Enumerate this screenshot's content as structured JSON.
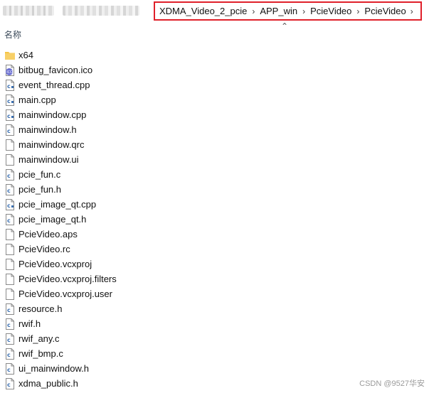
{
  "address_bar": {
    "breadcrumbs": [
      "XDMA_Video_2_pcie",
      "APP_win",
      "PcieVideo",
      "PcieVideo"
    ],
    "separator": "›"
  },
  "collapse_chevron": "⌃",
  "columns": {
    "name_header": "名称"
  },
  "files": [
    {
      "name": "x64",
      "icon": "folder-icon"
    },
    {
      "name": "bitbug_favicon.ico",
      "icon": "ico-file-icon"
    },
    {
      "name": "event_thread.cpp",
      "icon": "cpp-file-icon"
    },
    {
      "name": "main.cpp",
      "icon": "cpp-file-icon"
    },
    {
      "name": "mainwindow.cpp",
      "icon": "cpp-file-icon"
    },
    {
      "name": "mainwindow.h",
      "icon": "header-file-icon"
    },
    {
      "name": "mainwindow.qrc",
      "icon": "generic-file-icon"
    },
    {
      "name": "mainwindow.ui",
      "icon": "generic-file-icon"
    },
    {
      "name": "pcie_fun.c",
      "icon": "c-file-icon"
    },
    {
      "name": "pcie_fun.h",
      "icon": "header-file-icon"
    },
    {
      "name": "pcie_image_qt.cpp",
      "icon": "cpp-file-icon"
    },
    {
      "name": "pcie_image_qt.h",
      "icon": "header-file-icon"
    },
    {
      "name": "PcieVideo.aps",
      "icon": "generic-file-icon"
    },
    {
      "name": "PcieVideo.rc",
      "icon": "generic-file-icon"
    },
    {
      "name": "PcieVideo.vcxproj",
      "icon": "generic-file-icon"
    },
    {
      "name": "PcieVideo.vcxproj.filters",
      "icon": "generic-file-icon"
    },
    {
      "name": "PcieVideo.vcxproj.user",
      "icon": "generic-file-icon"
    },
    {
      "name": "resource.h",
      "icon": "header-file-icon"
    },
    {
      "name": "rwif.h",
      "icon": "header-file-icon"
    },
    {
      "name": "rwif_any.c",
      "icon": "c-file-icon"
    },
    {
      "name": "rwif_bmp.c",
      "icon": "c-file-icon"
    },
    {
      "name": "ui_mainwindow.h",
      "icon": "header-file-icon"
    },
    {
      "name": "xdma_public.h",
      "icon": "header-file-icon"
    }
  ],
  "watermark": "CSDN @9527华安",
  "colors": {
    "highlight_border": "#e0202a",
    "folder": "#f5c445",
    "ico_badge": "#6a6fd1"
  }
}
